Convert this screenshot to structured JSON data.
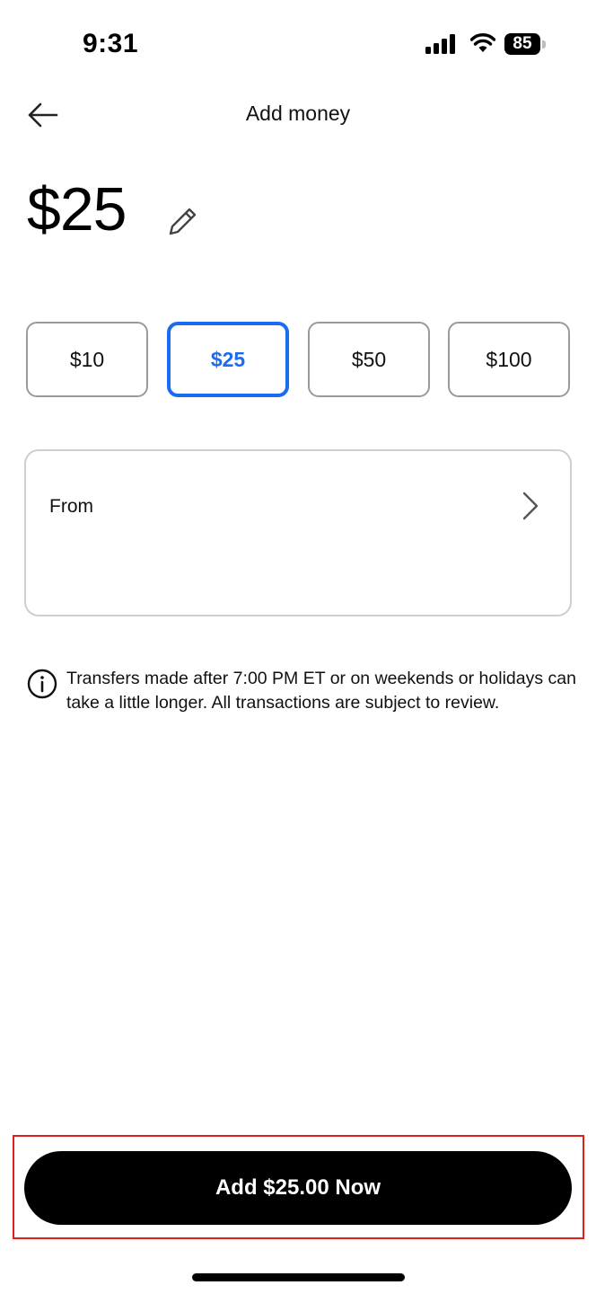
{
  "status_bar": {
    "time": "9:31",
    "battery": "85",
    "icons": [
      "signal-icon",
      "wifi-icon",
      "battery-icon"
    ]
  },
  "header": {
    "title": "Add money",
    "back_icon": "arrow-left-icon"
  },
  "amount": {
    "value": "$25",
    "edit_icon": "pencil-icon"
  },
  "presets": [
    {
      "label": "$10",
      "selected": false
    },
    {
      "label": "$25",
      "selected": true
    },
    {
      "label": "$50",
      "selected": false
    },
    {
      "label": "$100",
      "selected": false
    }
  ],
  "from": {
    "label": "From",
    "chevron_icon": "chevron-right-icon"
  },
  "info": {
    "icon": "info-icon",
    "text": "Transfers made after 7:00 PM ET or on weekends or holidays can take a little longer. All transactions are subject to review."
  },
  "cta": {
    "label": "Add $25.00 Now"
  },
  "colors": {
    "accent": "#1a6cf2",
    "cta_background": "#000000",
    "highlight_border": "#e0201b"
  }
}
